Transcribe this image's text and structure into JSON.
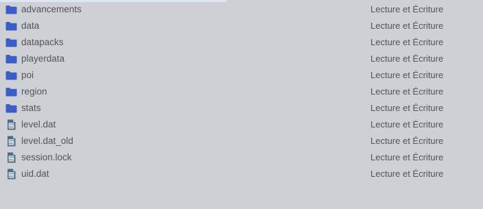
{
  "colors": {
    "background": "#ced0d6",
    "folder_icon": "#3d5dc6",
    "file_icon": "#4d6b86",
    "text": "#4f555c"
  },
  "files": [
    {
      "name": "advancements",
      "type": "folder",
      "icon": "folder-icon",
      "permissions": "Lecture et Écriture"
    },
    {
      "name": "data",
      "type": "folder",
      "icon": "folder-icon",
      "permissions": "Lecture et Écriture"
    },
    {
      "name": "datapacks",
      "type": "folder",
      "icon": "folder-icon",
      "permissions": "Lecture et Écriture"
    },
    {
      "name": "playerdata",
      "type": "folder",
      "icon": "folder-icon",
      "permissions": "Lecture et Écriture"
    },
    {
      "name": "poi",
      "type": "folder",
      "icon": "folder-icon",
      "permissions": "Lecture et Écriture"
    },
    {
      "name": "region",
      "type": "folder",
      "icon": "folder-icon",
      "permissions": "Lecture et Écriture"
    },
    {
      "name": "stats",
      "type": "folder",
      "icon": "folder-icon",
      "permissions": "Lecture et Écriture"
    },
    {
      "name": "level.dat",
      "type": "file",
      "icon": "binary-file-icon",
      "permissions": "Lecture et Écriture"
    },
    {
      "name": "level.dat_old",
      "type": "file",
      "icon": "binary-file-icon",
      "permissions": "Lecture et Écriture"
    },
    {
      "name": "session.lock",
      "type": "file",
      "icon": "binary-file-icon",
      "permissions": "Lecture et Écriture"
    },
    {
      "name": "uid.dat",
      "type": "file",
      "icon": "binary-file-icon",
      "permissions": "Lecture et Écriture"
    }
  ]
}
